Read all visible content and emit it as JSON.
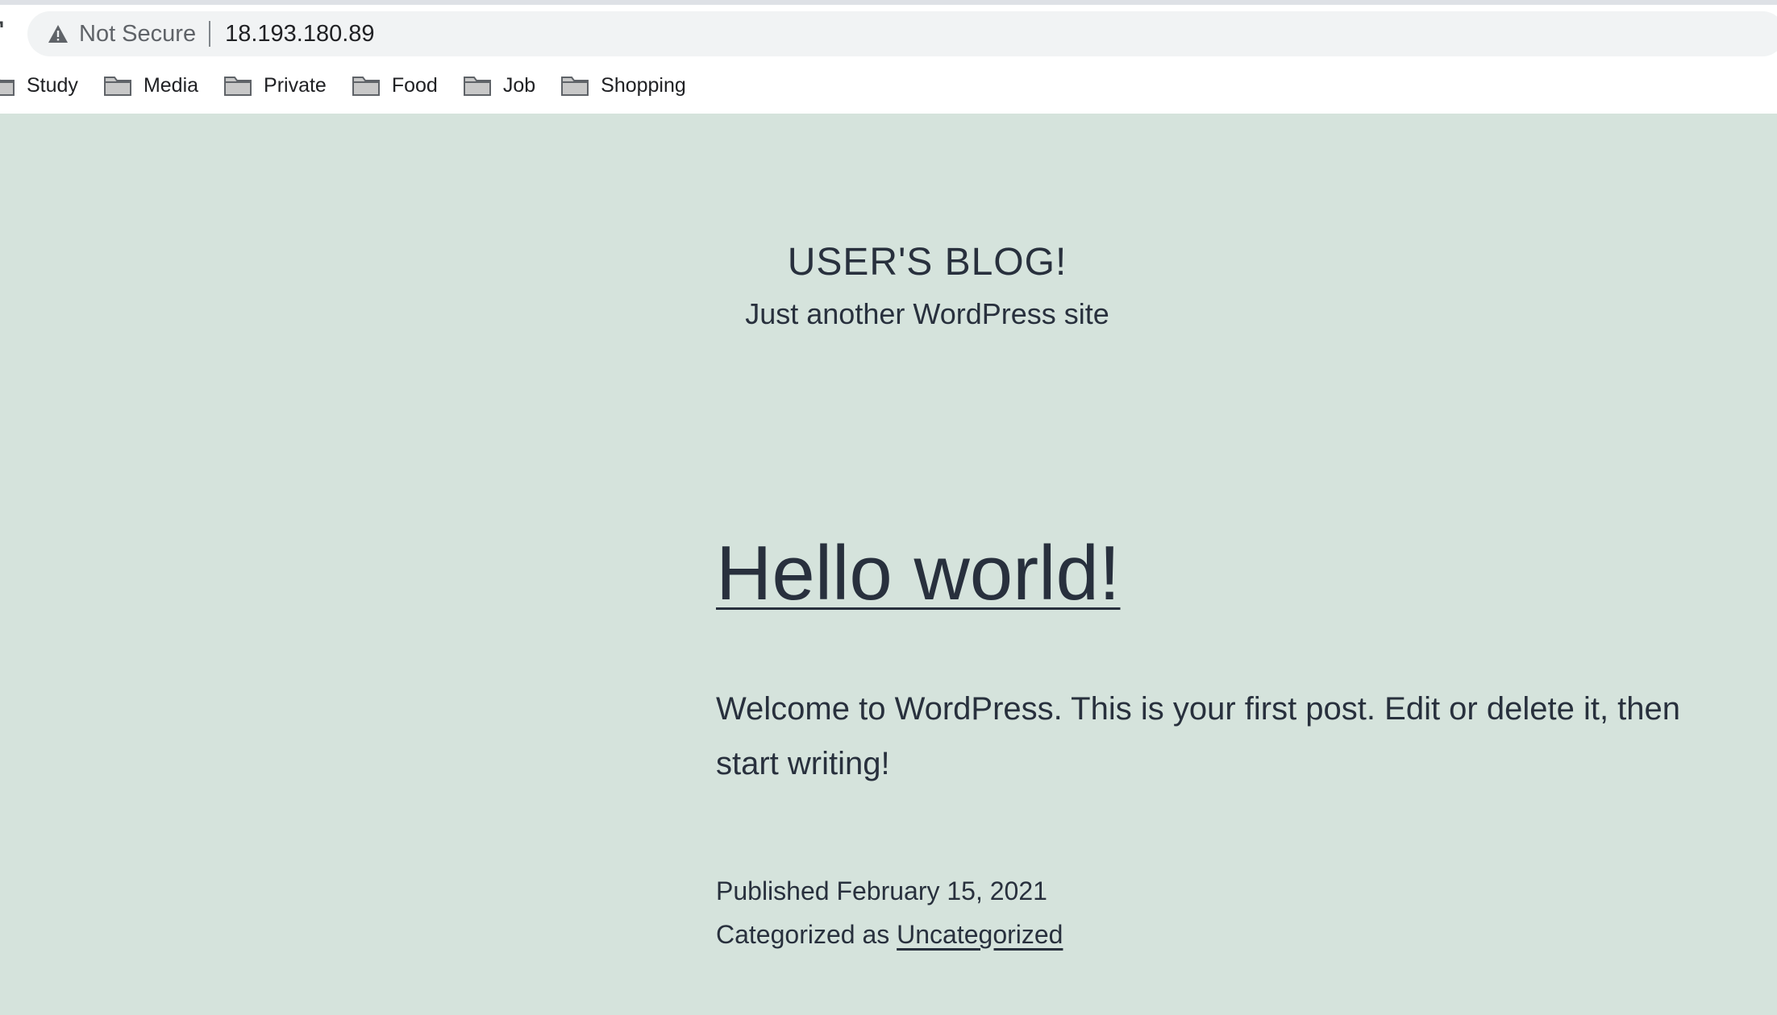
{
  "browser": {
    "security_label": "Not Secure",
    "url": "18.193.180.89",
    "bookmarks": [
      {
        "label": "Study"
      },
      {
        "label": "Media"
      },
      {
        "label": "Private"
      },
      {
        "label": "Food"
      },
      {
        "label": "Job"
      },
      {
        "label": "Shopping"
      }
    ]
  },
  "site": {
    "title": "USER'S BLOG!",
    "description": "Just another WordPress site"
  },
  "post": {
    "title": "Hello world!",
    "content": "Welcome to WordPress. This is your first post. Edit or delete it, then start writing!",
    "published_label": "Published February 15, 2021",
    "category_prefix": "Categorized as",
    "category_link": "Uncategorized"
  },
  "colors": {
    "page_background": "#d5e3dc",
    "text": "#28303d",
    "address_bar": "#f1f3f4"
  }
}
